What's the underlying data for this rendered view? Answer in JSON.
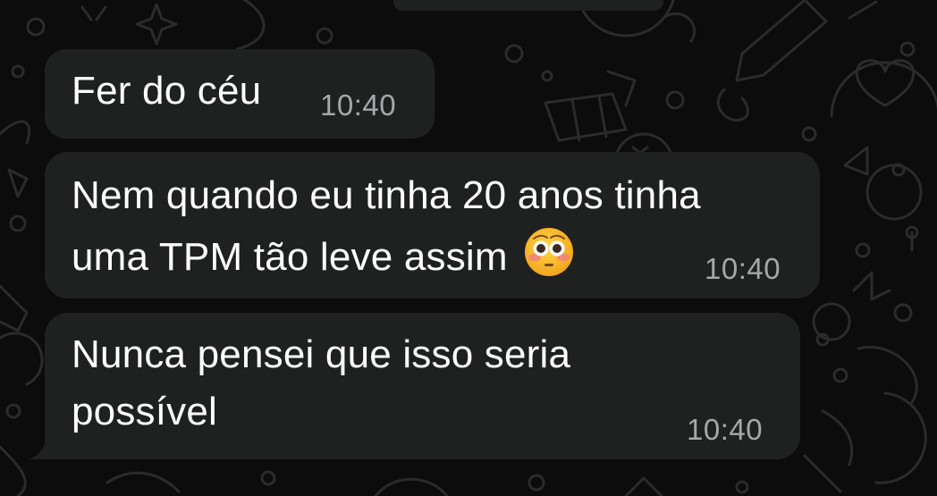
{
  "messages": [
    {
      "text": "Fer do céu",
      "time": "10:40"
    },
    {
      "text_lines": [
        "Nem quando eu tinha 20 anos tinha",
        "uma TPM tão leve assim"
      ],
      "emoji": "flushed-face-emoji",
      "time": "10:40"
    },
    {
      "text_lines": [
        "Nunca pensei que isso seria",
        "possível"
      ],
      "time": "10:40"
    }
  ],
  "colors": {
    "background": "#0c0c0c",
    "bubble": "#1f2020",
    "text": "#ffffff",
    "timestamp": "#a3a8a9",
    "doodle": "#2a2b2b"
  }
}
